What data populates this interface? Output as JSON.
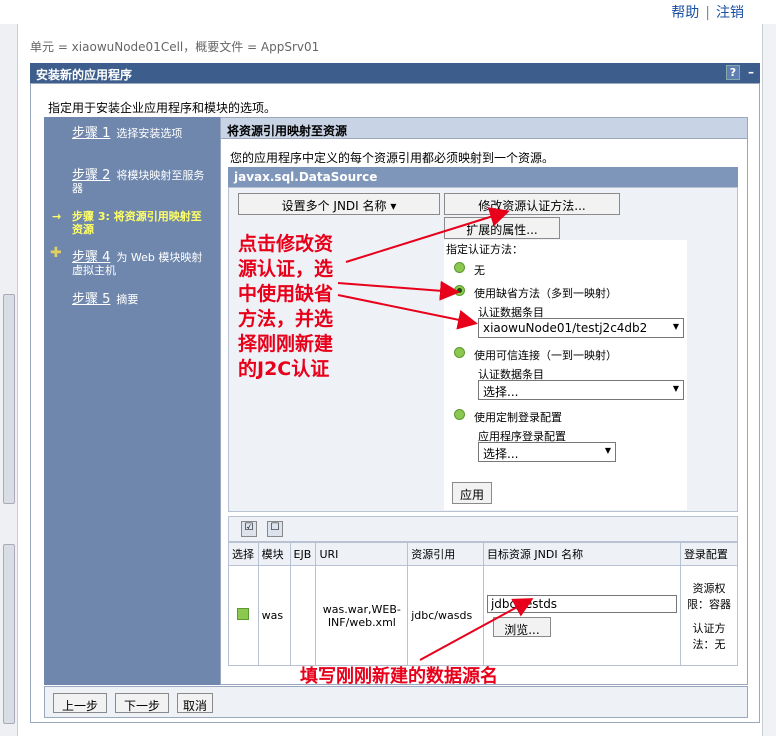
{
  "top": {
    "help": "帮助",
    "logout": "注销",
    "sep": "|"
  },
  "breadcrumb": "单元 = xiaowuNode01Cell，概要文件 = AppSrv01",
  "panel_title": "安装新的应用程序",
  "panel_help": "?",
  "panel_min": "–",
  "intro": "指定用于安装企业应用程序和模块的选项。",
  "steps": [
    {
      "link": "步骤 1",
      "text": "选择安装选项"
    },
    {
      "link": "步骤 2",
      "text": "将模块映射至服务器"
    },
    {
      "link": "步骤 3: 将资源引用映射至资源",
      "text": ""
    },
    {
      "link": "步骤 4",
      "text": "为 Web 模块映射虚拟主机"
    },
    {
      "link": "步骤 5",
      "text": "摘要"
    }
  ],
  "step_arrow": "→",
  "step_plus": "✚",
  "main_header": "将资源引用映射至资源",
  "main_desc": "您的应用程序中定义的每个资源引用都必须映射到一个资源。",
  "ds_header": "javax.sql.DataSource",
  "buttons": {
    "set_jndi": "设置多个 JNDI 名称",
    "modify_auth": "修改资源认证方法...",
    "ext_props": "扩展的属性...",
    "apply": "应用",
    "browse": "浏览...",
    "prev": "上一步",
    "next": "下一步",
    "cancel": "取消"
  },
  "auth": {
    "title": "指定认证方法：",
    "opt_none": "无",
    "opt_default": "使用缺省方法（多到一映射）",
    "auth_entry_label": "认证数据条目",
    "default_selected": "xiaowuNode01/testj2c4db2",
    "opt_trusted": "使用可信连接（一到一映射）",
    "trusted_label": "认证数据条目",
    "trusted_selected": "选择...",
    "opt_custom": "使用定制登录配置",
    "custom_label": "应用程序登录配置",
    "custom_selected": "选择..."
  },
  "table": {
    "headers": [
      "选择",
      "模块",
      "EJB",
      "URI",
      "资源引用",
      "目标资源 JNDI 名称",
      "登录配置"
    ],
    "row": {
      "module": "was",
      "ejb": "",
      "uri": "was.war,WEB-INF/web.xml",
      "ref": "jdbc/wasds",
      "jndi": "jdbc/testds",
      "login1": "资源权限：容器",
      "login2": "认证方法：无"
    }
  },
  "annotations": {
    "left": "点击修改资源认证，选中使用缺省方法，并选择刚刚新建的J2C认证",
    "bottom": "填写刚刚新建的数据源名"
  },
  "colors": {
    "annotation": "#e8001a",
    "title_bg": "#3d5d8c",
    "steps_bg": "#6f87ad"
  }
}
